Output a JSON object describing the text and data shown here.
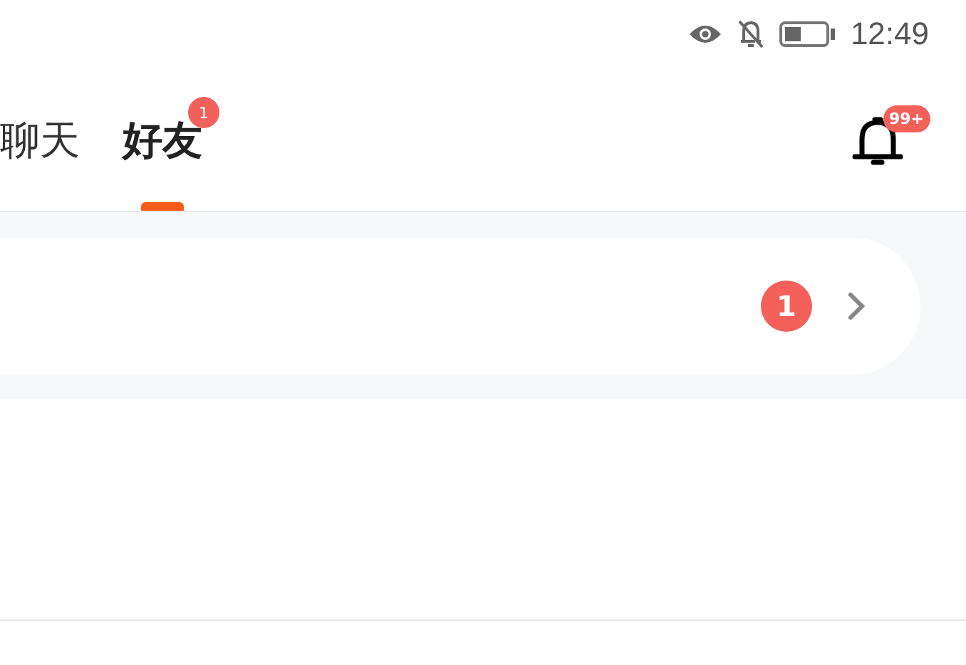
{
  "status_bar": {
    "time": "12:49"
  },
  "tabs": [
    {
      "label": "聊天",
      "selected": false
    },
    {
      "label": "好友",
      "selected": true,
      "badge": "1"
    }
  ],
  "notifications": {
    "badge": "99+"
  },
  "entry_card": {
    "badge": "1"
  }
}
